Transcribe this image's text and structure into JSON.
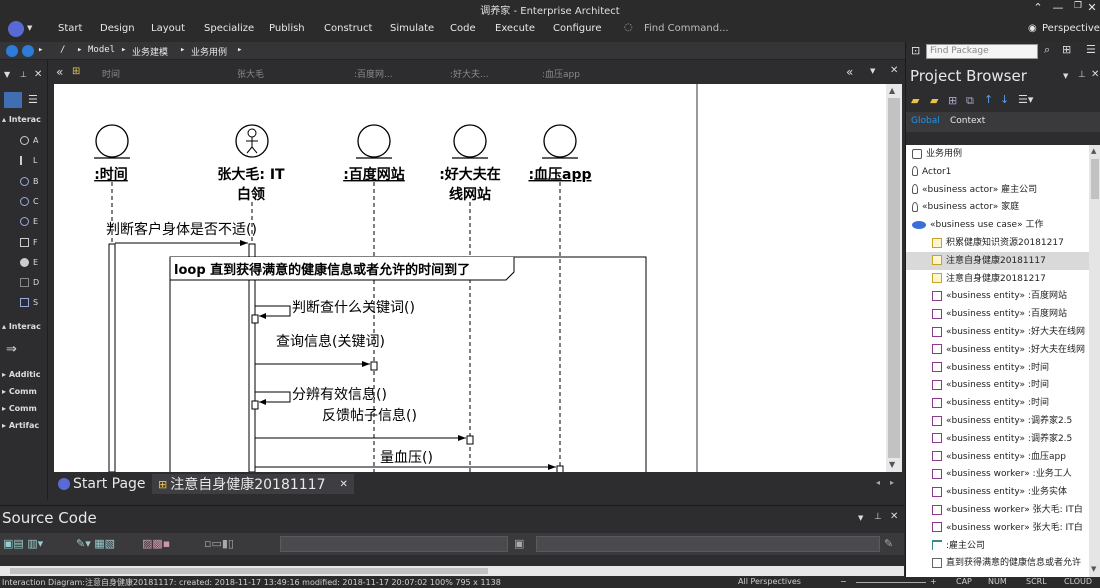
{
  "window": {
    "title": "调养家 - Enterprise Architect"
  },
  "menu": {
    "items": [
      "Start",
      "Design",
      "Layout",
      "Specialize",
      "Publish",
      "Construct",
      "Simulate",
      "Code",
      "Execute",
      "Configure"
    ],
    "find_command": "Find Command...",
    "perspective": "Perspective"
  },
  "breadcrumb": [
    "/",
    "Model",
    "业务建模",
    "业务用例"
  ],
  "toolbox": {
    "section1": "Interac",
    "items1": [
      "A",
      "L",
      "B",
      "C",
      "E",
      "F",
      "E",
      "D",
      "S"
    ],
    "section2": "Interac",
    "groups": [
      "Additic",
      "Comm",
      "Comm",
      "Artifac"
    ]
  },
  "diagram_tabs": [
    "时间",
    "张大毛",
    ":百度网...",
    ":好大夫...",
    ":血压app"
  ],
  "diagram": {
    "lifelines": [
      {
        "name": ":时间",
        "line2": ""
      },
      {
        "name": "张大毛: IT",
        "line2": "白领"
      },
      {
        "name": ":百度网站",
        "line2": ""
      },
      {
        "name": ":好大夫在",
        "line2": "线网站"
      },
      {
        "name": ":血压app",
        "line2": ""
      }
    ],
    "messages": [
      "判断客户身体是否不适()",
      "判断查什么关键词()",
      "查询信息(关键词)",
      "分辨有效信息()",
      "反馈帖子信息()",
      "量血压()"
    ],
    "loop_label": "loop 直到获得满意的健康信息或者允许的时间到了"
  },
  "bottom_tabs": {
    "start": "Start Page",
    "diagram": "注意自身健康20181117"
  },
  "source": {
    "title": "Source Code"
  },
  "project_browser": {
    "search_placeholder": "Find Package",
    "title": "Project Browser",
    "tabs": [
      "Global",
      "Context"
    ],
    "items": [
      {
        "label": "业务用例",
        "icon": "package-icon",
        "selected": false
      },
      {
        "label": "Actor1",
        "icon": "actor-icon",
        "selected": false
      },
      {
        "label": "«business actor» 雇主公司",
        "icon": "actor-icon",
        "selected": false
      },
      {
        "label": "«business actor» 家庭",
        "icon": "actor-icon",
        "selected": false
      },
      {
        "label": "«business use case» 工作",
        "icon": "usecase-icon",
        "selected": false
      },
      {
        "label": "积累健康知识资源20181217",
        "icon": "diagram-icon",
        "selected": false
      },
      {
        "label": "注意自身健康20181117",
        "icon": "diagram-icon",
        "selected": true
      },
      {
        "label": "注意自身健康20181217",
        "icon": "diagram-icon",
        "selected": false
      },
      {
        "label": "«business entity» :百度网站",
        "icon": "entity-icon",
        "selected": false
      },
      {
        "label": "«business entity» :百度网站",
        "icon": "entity-icon",
        "selected": false
      },
      {
        "label": "«business entity» :好大夫在线网",
        "icon": "entity-icon",
        "selected": false
      },
      {
        "label": "«business entity» :好大夫在线网",
        "icon": "entity-icon",
        "selected": false
      },
      {
        "label": "«business entity» :时间",
        "icon": "entity-icon",
        "selected": false
      },
      {
        "label": "«business entity» :时间",
        "icon": "entity-icon",
        "selected": false
      },
      {
        "label": "«business entity» :时间",
        "icon": "entity-icon",
        "selected": false
      },
      {
        "label": "«business entity» :调养家2.5",
        "icon": "entity-icon",
        "selected": false
      },
      {
        "label": "«business entity» :调养家2.5",
        "icon": "entity-icon",
        "selected": false
      },
      {
        "label": "«business entity» :血压app",
        "icon": "entity-icon",
        "selected": false
      },
      {
        "label": "«business worker» :业务工人",
        "icon": "entity-icon",
        "selected": false
      },
      {
        "label": "«business entity» :业务实体",
        "icon": "entity-icon",
        "selected": false
      },
      {
        "label": "«business worker» 张大毛: IT白",
        "icon": "entity-icon",
        "selected": false
      },
      {
        "label": "«business worker» 张大毛: IT白",
        "icon": "entity-icon",
        "selected": false
      },
      {
        "label": ":雇主公司",
        "icon": "boundary-icon",
        "selected": false
      },
      {
        "label": "直到获得满意的健康信息或者允许",
        "icon": "note-icon",
        "selected": false
      }
    ]
  },
  "status": {
    "left": "Interaction Diagram:注意自身健康20181117:  created: 2018-11-17 13:49:16  modified: 2018-11-17 20:07:02   100%   795 x 1138",
    "perspectives": "All Perspectives",
    "indicators": [
      "CAP",
      "NUM",
      "SCRL",
      "CLOUD"
    ]
  },
  "colors": {
    "accent": "#1c97ea",
    "selected_row": "#d9d9d9",
    "app_bg": "#2d2d30"
  }
}
